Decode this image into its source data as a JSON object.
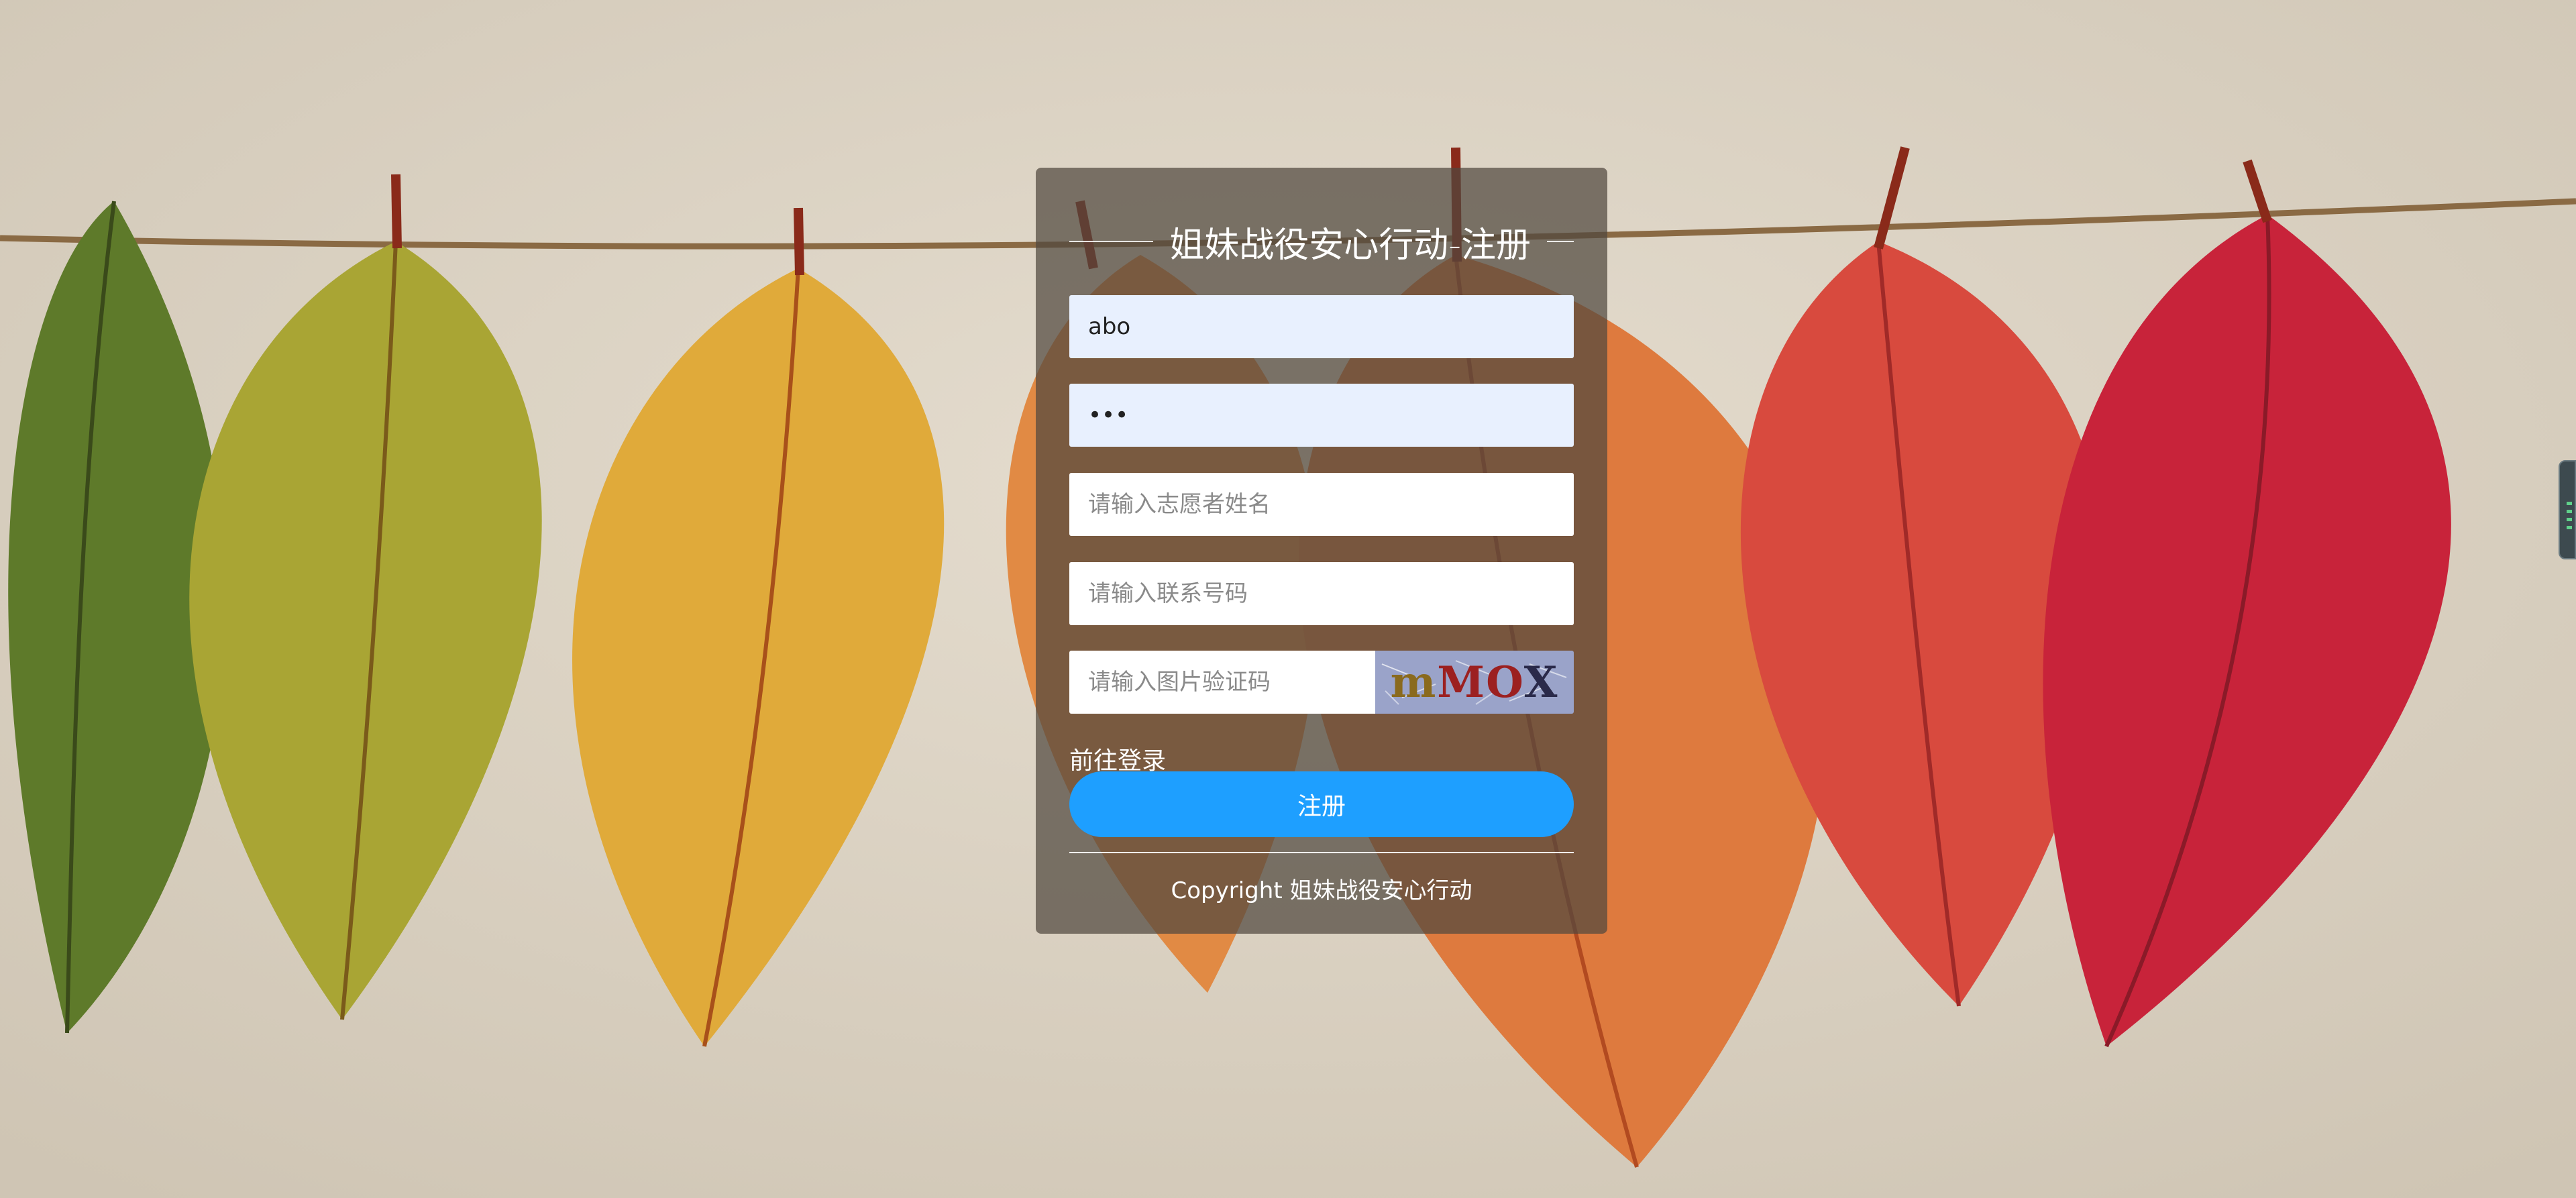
{
  "form": {
    "title": "姐妹战役安心行动-注册",
    "username": {
      "value": "abo"
    },
    "password": {
      "value": "abc"
    },
    "name_field": {
      "placeholder": "请输入志愿者姓名"
    },
    "phone_field": {
      "placeholder": "请输入联系号码"
    },
    "captcha_field": {
      "placeholder": "请输入图片验证码"
    },
    "captcha_image_text": "mMOX",
    "login_link": "前往登录",
    "register_button": "注册",
    "copyright": "Copyright 姐妹战役安心行动"
  },
  "colors": {
    "primary_button": "#1e9fff",
    "card_overlay": "rgba(80,72,62,0.72)",
    "autofill_bg": "#e8f0fe"
  }
}
